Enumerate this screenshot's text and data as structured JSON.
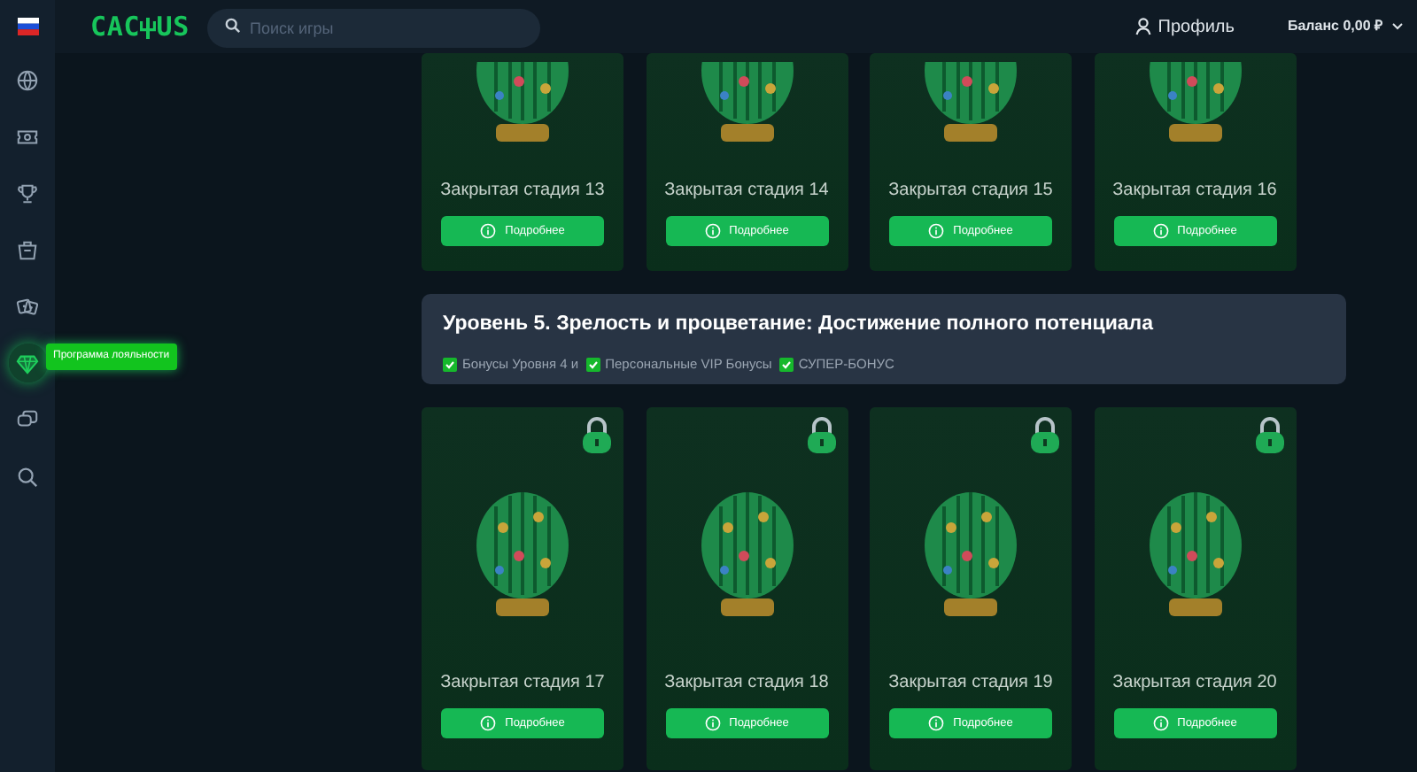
{
  "header": {
    "logo_left": "CAC",
    "logo_right": "US",
    "search": {
      "placeholder": "Поиск игры"
    },
    "profile": "Профиль",
    "balance": "Баланс 0,00 ₽"
  },
  "sidebar": {
    "items": [
      {
        "selected": false
      },
      {
        "selected": false
      },
      {
        "selected": false
      },
      {
        "selected": false
      },
      {
        "selected": false
      },
      {
        "selected": true,
        "tooltip": "Программа лояльности"
      },
      {
        "selected": false
      },
      {
        "selected": false
      }
    ]
  },
  "top_stages": [
    {
      "title": "Закрытая стадия 13",
      "button": "Подробнее",
      "locked": false
    },
    {
      "title": "Закрытая стадия 14",
      "button": "Подробнее",
      "locked": false
    },
    {
      "title": "Закрытая стадия 15",
      "button": "Подробнее",
      "locked": false
    },
    {
      "title": "Закрытая стадия 16",
      "button": "Подробнее",
      "locked": false
    }
  ],
  "level": {
    "title": "Уровень 5. Зрелость и процветание: Достижение полного потенциала",
    "bonuses": [
      {
        "label": "Бонусы Уровня 4 и",
        "checked": true
      },
      {
        "label": "Персональные VIP Бонусы",
        "checked": true
      },
      {
        "label": "СУПЕР-БОНУС",
        "checked": true
      }
    ]
  },
  "bottom_stages": [
    {
      "title": "Закрытая стадия 17",
      "button": "Подробнее",
      "locked": true
    },
    {
      "title": "Закрытая стадия 18",
      "button": "Подробнее",
      "locked": true
    },
    {
      "title": "Закрытая стадия 19",
      "button": "Подробнее",
      "locked": true
    },
    {
      "title": "Закрытая стадия 20",
      "button": "Подробнее",
      "locked": true
    }
  ]
}
